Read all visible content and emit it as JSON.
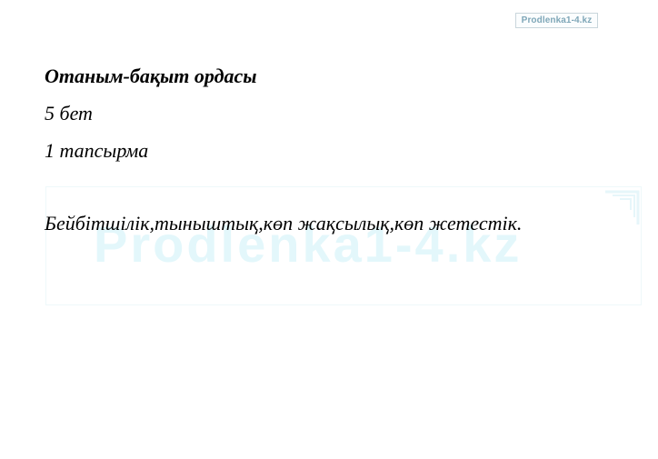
{
  "watermark": {
    "badge_text": "Prodlenka1-4.kz",
    "large_text": "Prodlenka1-4.kz",
    "color": "#e3f7fb"
  },
  "document": {
    "title": "Отаным-бақыт ордасы",
    "page_ref": "5 бет",
    "task_ref": "1 тапсырма",
    "answer": "Бейбітшілік,тыныштық,көп жақсылық,көп жетестік."
  }
}
